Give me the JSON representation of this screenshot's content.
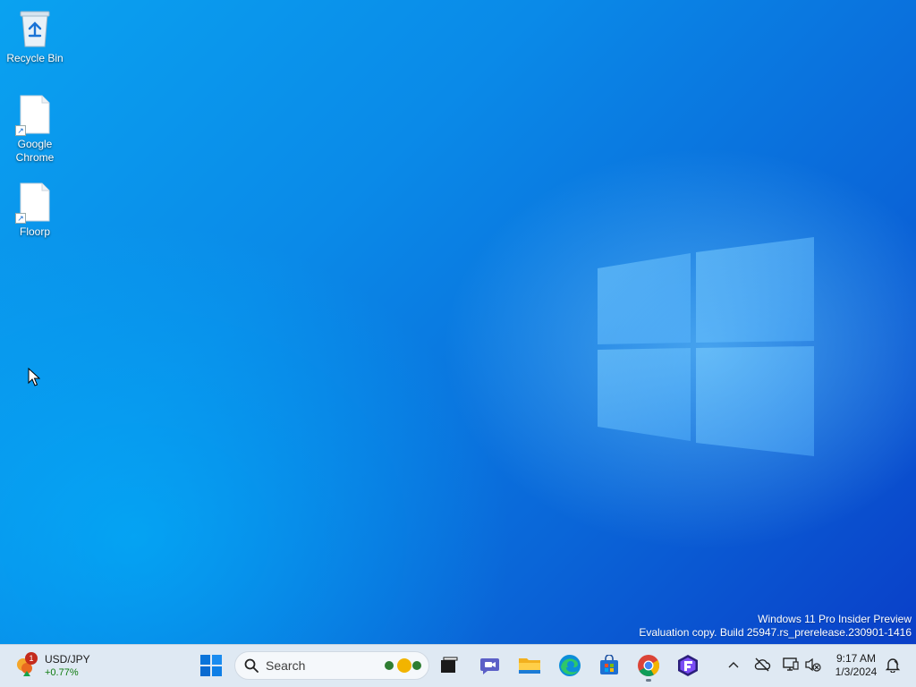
{
  "desktop": {
    "icons": [
      {
        "label": "Recycle Bin",
        "icon": "recycle-bin-icon"
      },
      {
        "label": "Google Chrome",
        "icon": "shortcut-file-icon"
      },
      {
        "label": "Floorp",
        "icon": "shortcut-file-icon"
      }
    ],
    "watermark": {
      "line1": "Windows 11 Pro Insider Preview",
      "line2": "Evaluation copy. Build 25947.rs_prerelease.230901-1416"
    }
  },
  "taskbar": {
    "widget": {
      "symbol": "USD/JPY",
      "change": "+0.77%",
      "badge": "1"
    },
    "start_icon": "windows-start-icon",
    "search": {
      "placeholder": "Search"
    },
    "apps": [
      {
        "name": "task-view",
        "icon": "task-view-icon"
      },
      {
        "name": "meet-now",
        "icon": "camera-chat-icon"
      },
      {
        "name": "file-explorer",
        "icon": "folder-icon"
      },
      {
        "name": "edge",
        "icon": "edge-icon"
      },
      {
        "name": "store",
        "icon": "store-icon"
      },
      {
        "name": "chrome",
        "icon": "chrome-icon"
      },
      {
        "name": "floorp",
        "icon": "floorp-icon"
      }
    ],
    "tray": {
      "time": "9:17 AM",
      "date": "1/3/2024"
    }
  },
  "colors": {
    "accent": "#0078d4",
    "taskbar_bg": "#dfe9f3",
    "positive": "#0f7b0f",
    "badge": "#c42b1c"
  }
}
